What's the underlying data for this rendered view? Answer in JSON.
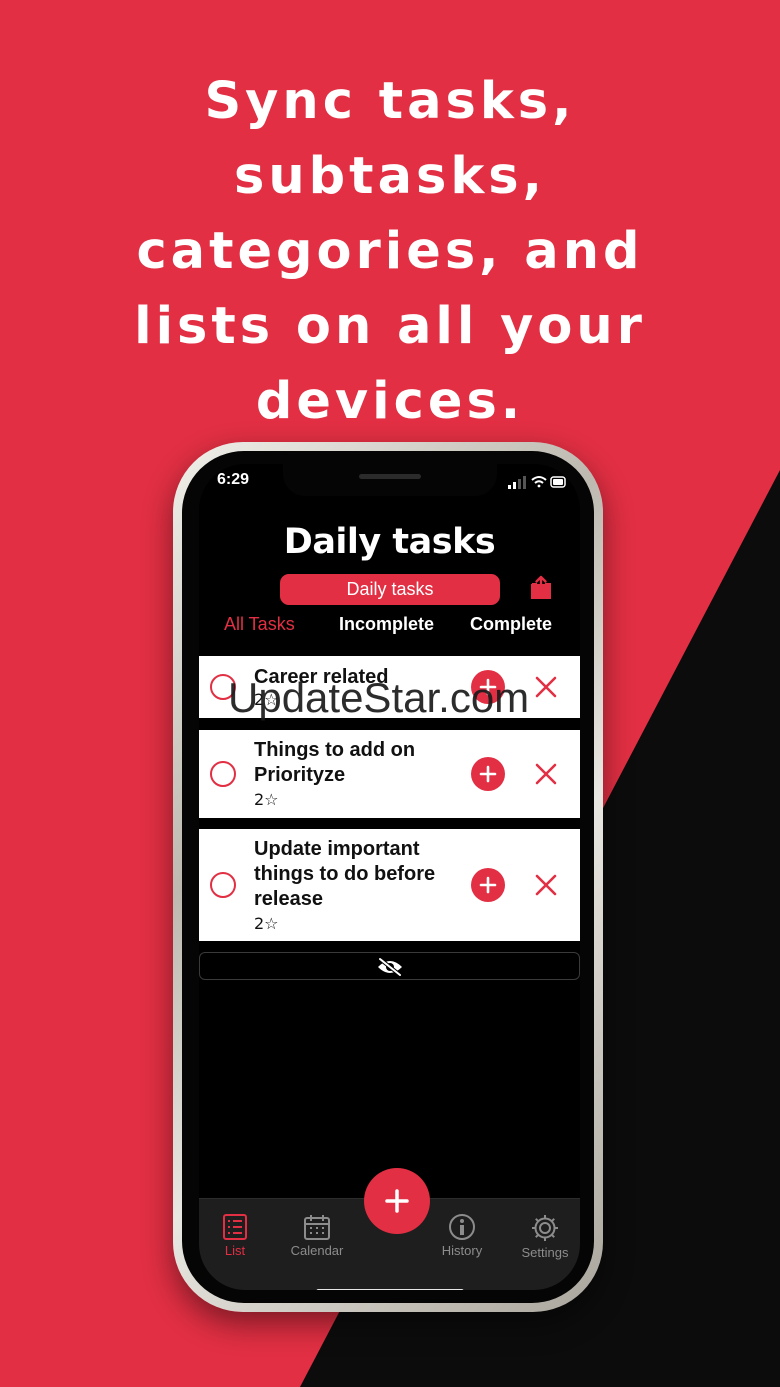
{
  "headline": {
    "lines": [
      "Sync tasks,",
      "subtasks,",
      "categories, and",
      "lists on all your",
      "devices."
    ]
  },
  "status_bar": {
    "time": "6:29"
  },
  "header": {
    "title": "Daily tasks",
    "list_selector": "Daily tasks"
  },
  "filters": [
    {
      "label": "All Tasks",
      "active": true
    },
    {
      "label": "Incomplete",
      "active": false
    },
    {
      "label": "Complete",
      "active": false
    }
  ],
  "tasks": [
    {
      "title": "Career related",
      "stars": "2☆"
    },
    {
      "title": "Things to add on Priorityze",
      "stars": "2☆"
    },
    {
      "title": "Update important things to do before release",
      "stars": "2☆"
    }
  ],
  "watermark": "UpdateStar.com",
  "tabbar": [
    {
      "label": "List",
      "icon": "list-icon",
      "active": true
    },
    {
      "label": "Calendar",
      "icon": "calendar-icon",
      "active": false
    },
    {
      "label": "History",
      "icon": "info-icon",
      "active": false
    },
    {
      "label": "Settings",
      "icon": "gear-icon",
      "active": false
    }
  ],
  "colors": {
    "accent": "#e22f43",
    "dark": "#0c0c0c",
    "tabbar": "#1e1e1e"
  }
}
